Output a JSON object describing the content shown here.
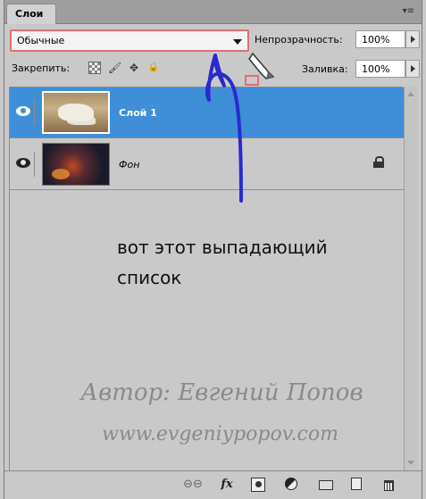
{
  "panel": {
    "tab_label": "Слои",
    "menu_icon": "panel-menu-icon"
  },
  "blend_mode": {
    "selected": "Обычные"
  },
  "opacity": {
    "label": "Непрозрачность:",
    "value": "100%"
  },
  "lock": {
    "label": "Закрепить:",
    "icons": [
      "lock-transparent-icon",
      "lock-paint-brush-icon",
      "lock-move-icon",
      "lock-all-icon"
    ],
    "brush_glyph": "🖌",
    "move_glyph": "✥",
    "all_glyph": "🔒"
  },
  "fill": {
    "label": "Заливка:",
    "value": "100%"
  },
  "layers": [
    {
      "name": "Слой 1",
      "selected": true,
      "visible": true,
      "locked": false
    },
    {
      "name": "Фон",
      "selected": false,
      "visible": true,
      "locked": true
    }
  ],
  "annotation": {
    "line1": "вот этот выпадающий",
    "line2": "список"
  },
  "watermark": {
    "author": "Автор: Евгений Попов",
    "site": "www.evgeniypopov.com"
  },
  "bottom_bar": {
    "link_glyph": "⊖⊖",
    "fx_label": "fx",
    "icons": [
      "link-layers-icon",
      "fx-icon",
      "layer-mask-icon",
      "adjustment-layer-icon",
      "group-folder-icon",
      "new-layer-icon",
      "trash-icon"
    ]
  },
  "colors": {
    "selection": "#3e8ed8",
    "highlight_box": "#e07070",
    "annotation_arrow": "#2a2ad0"
  }
}
